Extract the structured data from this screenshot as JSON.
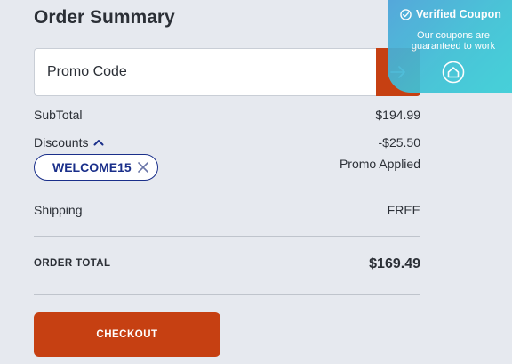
{
  "order_summary": {
    "title": "Order Summary",
    "promo": {
      "placeholder": "Promo Code",
      "submit_icon": "arrow-right-icon"
    },
    "subtotal": {
      "label": "SubTotal",
      "value": "$194.99"
    },
    "discounts": {
      "label": "Discounts",
      "value": "-$25.50",
      "note": "Promo Applied",
      "toggle_icon": "chevron-up-icon"
    },
    "applied_code": {
      "code": "WELCOME15",
      "remove_icon": "close-icon"
    },
    "shipping": {
      "label": "Shipping",
      "value": "FREE"
    },
    "total": {
      "label": "ORDER TOTAL",
      "value": "$169.49"
    },
    "checkout_label": "CHECKOUT"
  },
  "coupon_badge": {
    "title": "Verified Coupon",
    "subtitle": "Our coupons are guaranteed to work",
    "check_icon": "check-circle-icon",
    "logo_icon": "house-logo-icon"
  },
  "colors": {
    "accent": "#c64012",
    "chip_text": "#1a2f8a",
    "background": "#e6e9ef"
  }
}
